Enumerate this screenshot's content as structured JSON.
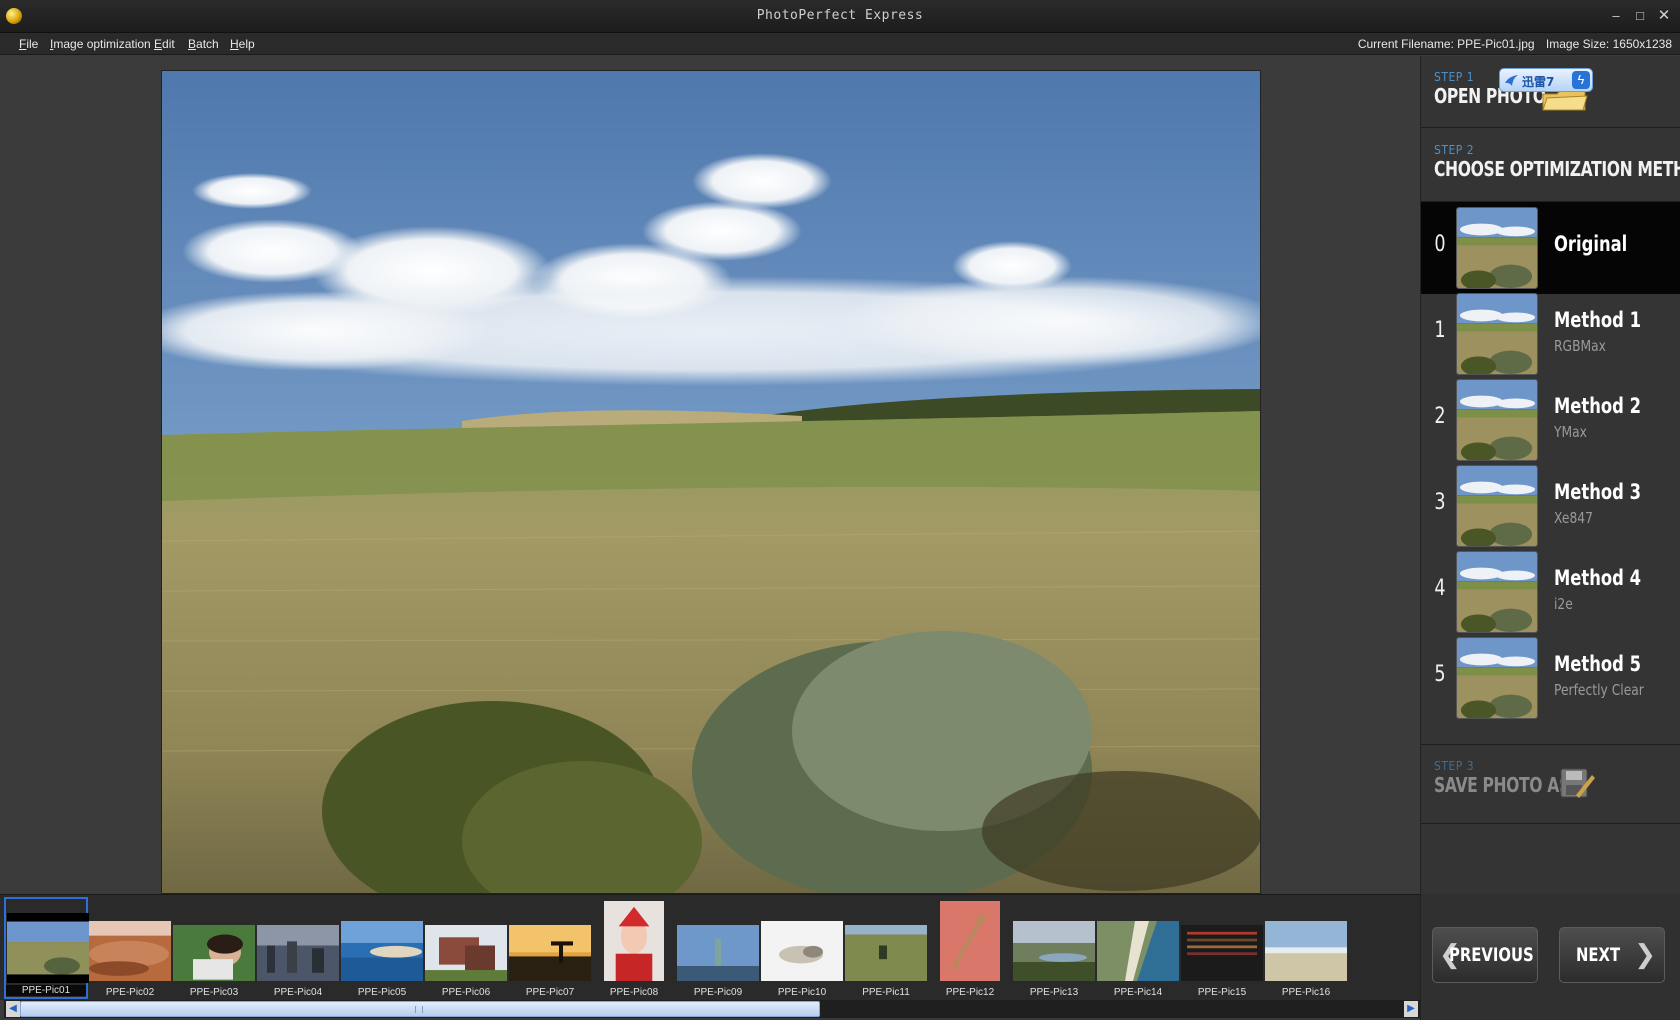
{
  "window": {
    "title": "PhotoPerfect Express",
    "min_glyph": "–",
    "max_glyph": "□",
    "close_glyph": "✕"
  },
  "menu": {
    "file_u": "F",
    "file_rest": "ile",
    "imgopt_u": "I",
    "imgopt_rest": "mage optimization",
    "edit_u": "E",
    "edit_rest": "dit",
    "batch_u": "B",
    "batch_rest": "atch",
    "help_u": "H",
    "help_rest": "elp"
  },
  "file_info": {
    "filename": "Current Filename: PPE-Pic01.jpg",
    "size": "Image Size: 1650x1238"
  },
  "steps": {
    "step1_label": "STEP 1",
    "step1_title": "OPEN PHOTO",
    "step2_label": "STEP 2",
    "step2_title": "CHOOSE OPTIMIZATION METHOD:",
    "step3_label": "STEP 3",
    "step3_title": "SAVE PHOTO AS"
  },
  "badge": {
    "text": "迅雷7",
    "bolt": "ϟ"
  },
  "methods": [
    {
      "num": "0",
      "name": "Original",
      "sub": ""
    },
    {
      "num": "1",
      "name": "Method 1",
      "sub": "RGBMax"
    },
    {
      "num": "2",
      "name": "Method 2",
      "sub": "YMax"
    },
    {
      "num": "3",
      "name": "Method 3",
      "sub": "Xe847"
    },
    {
      "num": "4",
      "name": "Method 4",
      "sub": "i2e"
    },
    {
      "num": "5",
      "name": "Method 5",
      "sub": "Perfectly Clear"
    }
  ],
  "thumbnails": [
    "PPE-Pic01",
    "PPE-Pic02",
    "PPE-Pic03",
    "PPE-Pic04",
    "PPE-Pic05",
    "PPE-Pic06",
    "PPE-Pic07",
    "PPE-Pic08",
    "PPE-Pic09",
    "PPE-Pic10",
    "PPE-Pic11",
    "PPE-Pic12",
    "PPE-Pic13",
    "PPE-Pic14",
    "PPE-Pic15",
    "PPE-Pic16"
  ],
  "nav": {
    "previous": "PREVIOUS",
    "next": "NEXT",
    "prev_chev": "❮",
    "next_chev": "❯"
  },
  "scroll": {
    "left": "◀",
    "right": "▶"
  }
}
